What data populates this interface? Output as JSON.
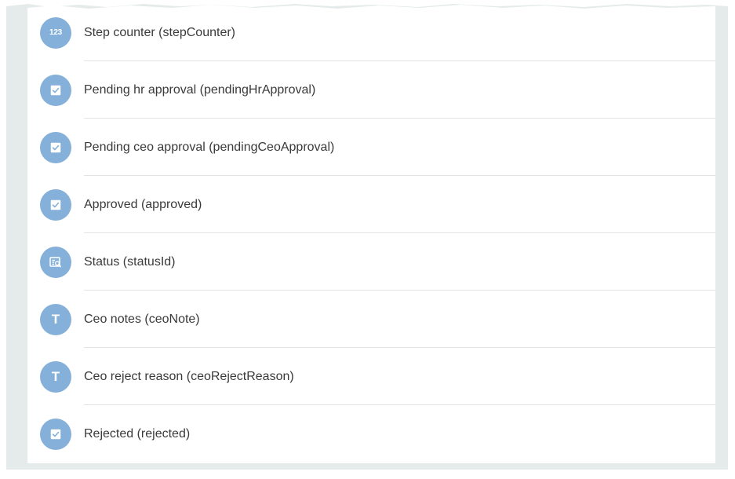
{
  "fields": [
    {
      "label": "Step counter (stepCounter)",
      "icon": "number-icon",
      "glyph": "123"
    },
    {
      "label": "Pending hr approval (pendingHrApproval)",
      "icon": "checkbox-icon"
    },
    {
      "label": "Pending ceo approval (pendingCeoApproval)",
      "icon": "checkbox-icon"
    },
    {
      "label": "Approved (approved)",
      "icon": "checkbox-icon"
    },
    {
      "label": "Status (statusId)",
      "icon": "lookup-icon"
    },
    {
      "label": "Ceo notes (ceoNote)",
      "icon": "text-icon",
      "glyph": "T"
    },
    {
      "label": "Ceo reject reason (ceoRejectReason)",
      "icon": "text-icon",
      "glyph": "T"
    },
    {
      "label": "Rejected (rejected)",
      "icon": "checkbox-icon"
    }
  ],
  "colors": {
    "icon_background": "#84b0d9",
    "label_text": "#3a3a3a",
    "divider": "#e3e3e3",
    "outer_background": "#e4ebea"
  }
}
